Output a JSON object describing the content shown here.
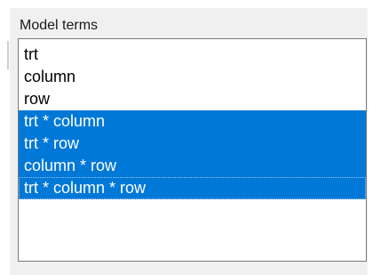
{
  "group": {
    "label": "Model terms"
  },
  "terms": {
    "items": [
      {
        "label": "trt",
        "selected": false
      },
      {
        "label": "column",
        "selected": false
      },
      {
        "label": "row",
        "selected": false
      },
      {
        "label": "trt * column",
        "selected": true
      },
      {
        "label": "trt * row",
        "selected": true
      },
      {
        "label": "column * row",
        "selected": true
      },
      {
        "label": "trt * column * row",
        "selected": true,
        "focused": true
      }
    ]
  },
  "colors": {
    "selection_bg": "#0078d7",
    "selection_text": "#ffffff",
    "panel_bg": "#f0f0f0",
    "list_border": "#7a7a7a"
  }
}
